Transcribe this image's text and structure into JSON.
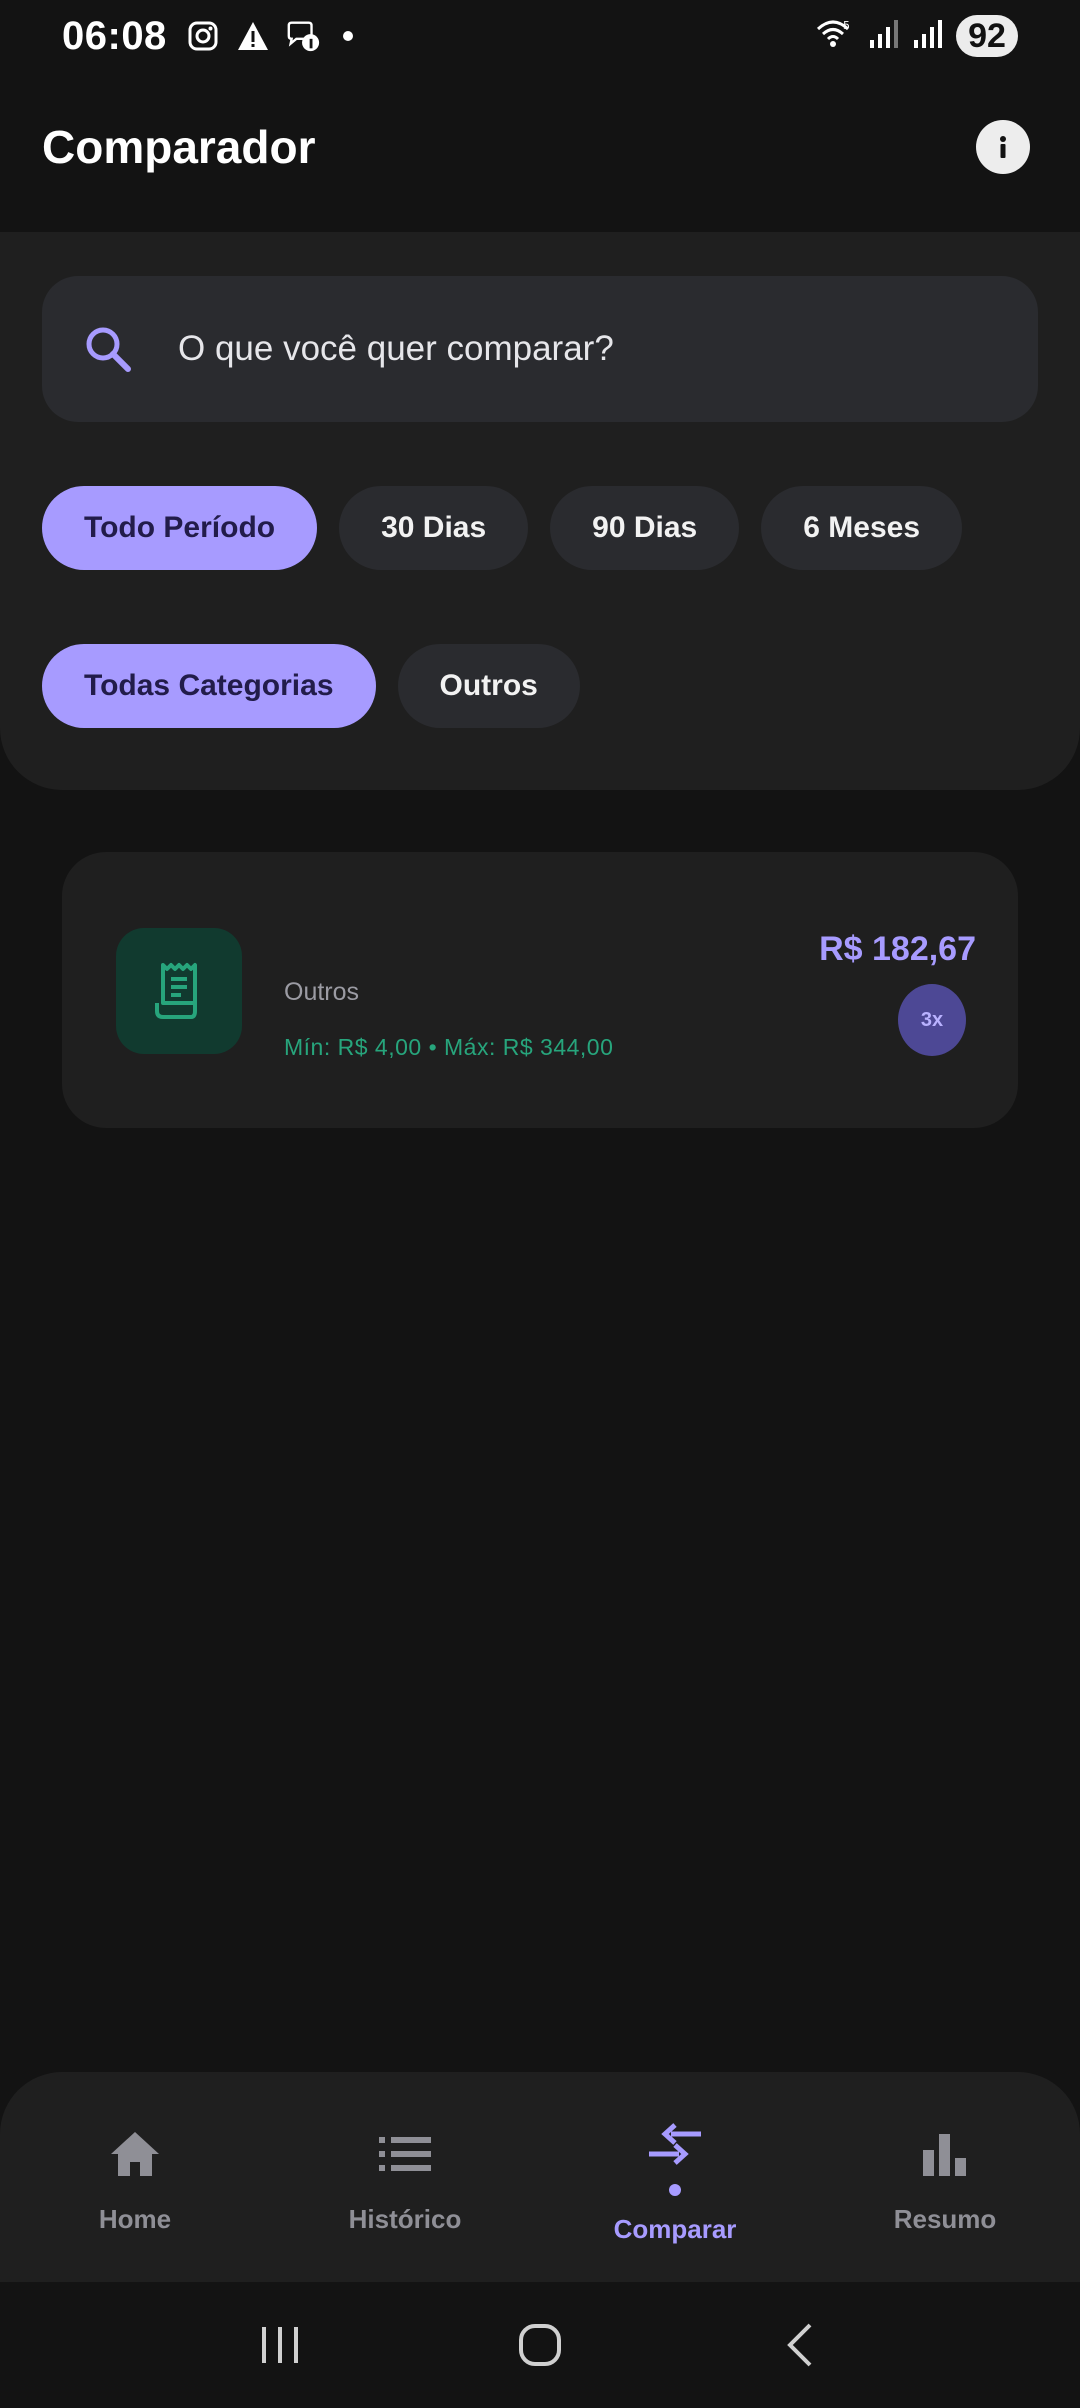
{
  "status_bar": {
    "time": "06:08",
    "battery": "92",
    "icons": [
      "instagram-icon",
      "warning-icon",
      "messenger-icon",
      "wifi-icon",
      "signal-icon",
      "signal-icon"
    ]
  },
  "header": {
    "title": "Comparador",
    "info_icon": "info-icon"
  },
  "search": {
    "placeholder": "O que você quer comparar?",
    "icon": "search-icon"
  },
  "period_filters": [
    {
      "label": "Todo Período",
      "active": true
    },
    {
      "label": "30 Dias",
      "active": false
    },
    {
      "label": "90 Dias",
      "active": false
    },
    {
      "label": "6 Meses",
      "active": false
    }
  ],
  "category_filters": [
    {
      "label": "Todas Categorias",
      "active": true
    },
    {
      "label": "Outros",
      "active": false
    }
  ],
  "results": [
    {
      "category": "Outros",
      "range": "Mín: R$ 4,00 • Máx: R$ 344,00",
      "price": "R$ 182,67",
      "count": "3x",
      "icon": "receipt-icon"
    }
  ],
  "bottom_nav": [
    {
      "label": "Home",
      "icon": "home-icon",
      "active": false
    },
    {
      "label": "Histórico",
      "icon": "list-icon",
      "active": false
    },
    {
      "label": "Comparar",
      "icon": "compare-arrows-icon",
      "active": true
    },
    {
      "label": "Resumo",
      "icon": "bar-chart-icon",
      "active": false
    }
  ],
  "colors": {
    "background": "#131313",
    "surface": "#1f1f1f",
    "chip": "#2a2b2f",
    "accent": "#a79bff",
    "green": "#27a57c"
  }
}
